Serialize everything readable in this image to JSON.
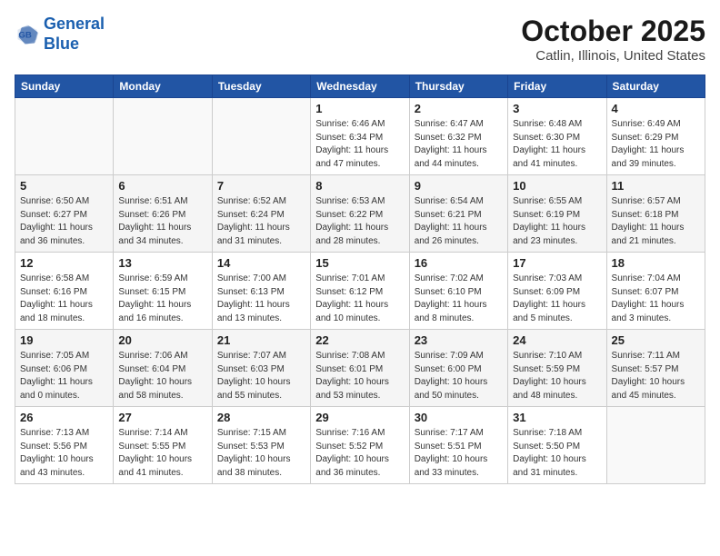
{
  "header": {
    "logo_line1": "General",
    "logo_line2": "Blue",
    "month": "October 2025",
    "location": "Catlin, Illinois, United States"
  },
  "weekdays": [
    "Sunday",
    "Monday",
    "Tuesday",
    "Wednesday",
    "Thursday",
    "Friday",
    "Saturday"
  ],
  "weeks": [
    [
      {
        "day": "",
        "info": ""
      },
      {
        "day": "",
        "info": ""
      },
      {
        "day": "",
        "info": ""
      },
      {
        "day": "1",
        "info": "Sunrise: 6:46 AM\nSunset: 6:34 PM\nDaylight: 11 hours and 47 minutes."
      },
      {
        "day": "2",
        "info": "Sunrise: 6:47 AM\nSunset: 6:32 PM\nDaylight: 11 hours and 44 minutes."
      },
      {
        "day": "3",
        "info": "Sunrise: 6:48 AM\nSunset: 6:30 PM\nDaylight: 11 hours and 41 minutes."
      },
      {
        "day": "4",
        "info": "Sunrise: 6:49 AM\nSunset: 6:29 PM\nDaylight: 11 hours and 39 minutes."
      }
    ],
    [
      {
        "day": "5",
        "info": "Sunrise: 6:50 AM\nSunset: 6:27 PM\nDaylight: 11 hours and 36 minutes."
      },
      {
        "day": "6",
        "info": "Sunrise: 6:51 AM\nSunset: 6:26 PM\nDaylight: 11 hours and 34 minutes."
      },
      {
        "day": "7",
        "info": "Sunrise: 6:52 AM\nSunset: 6:24 PM\nDaylight: 11 hours and 31 minutes."
      },
      {
        "day": "8",
        "info": "Sunrise: 6:53 AM\nSunset: 6:22 PM\nDaylight: 11 hours and 28 minutes."
      },
      {
        "day": "9",
        "info": "Sunrise: 6:54 AM\nSunset: 6:21 PM\nDaylight: 11 hours and 26 minutes."
      },
      {
        "day": "10",
        "info": "Sunrise: 6:55 AM\nSunset: 6:19 PM\nDaylight: 11 hours and 23 minutes."
      },
      {
        "day": "11",
        "info": "Sunrise: 6:57 AM\nSunset: 6:18 PM\nDaylight: 11 hours and 21 minutes."
      }
    ],
    [
      {
        "day": "12",
        "info": "Sunrise: 6:58 AM\nSunset: 6:16 PM\nDaylight: 11 hours and 18 minutes."
      },
      {
        "day": "13",
        "info": "Sunrise: 6:59 AM\nSunset: 6:15 PM\nDaylight: 11 hours and 16 minutes."
      },
      {
        "day": "14",
        "info": "Sunrise: 7:00 AM\nSunset: 6:13 PM\nDaylight: 11 hours and 13 minutes."
      },
      {
        "day": "15",
        "info": "Sunrise: 7:01 AM\nSunset: 6:12 PM\nDaylight: 11 hours and 10 minutes."
      },
      {
        "day": "16",
        "info": "Sunrise: 7:02 AM\nSunset: 6:10 PM\nDaylight: 11 hours and 8 minutes."
      },
      {
        "day": "17",
        "info": "Sunrise: 7:03 AM\nSunset: 6:09 PM\nDaylight: 11 hours and 5 minutes."
      },
      {
        "day": "18",
        "info": "Sunrise: 7:04 AM\nSunset: 6:07 PM\nDaylight: 11 hours and 3 minutes."
      }
    ],
    [
      {
        "day": "19",
        "info": "Sunrise: 7:05 AM\nSunset: 6:06 PM\nDaylight: 11 hours and 0 minutes."
      },
      {
        "day": "20",
        "info": "Sunrise: 7:06 AM\nSunset: 6:04 PM\nDaylight: 10 hours and 58 minutes."
      },
      {
        "day": "21",
        "info": "Sunrise: 7:07 AM\nSunset: 6:03 PM\nDaylight: 10 hours and 55 minutes."
      },
      {
        "day": "22",
        "info": "Sunrise: 7:08 AM\nSunset: 6:01 PM\nDaylight: 10 hours and 53 minutes."
      },
      {
        "day": "23",
        "info": "Sunrise: 7:09 AM\nSunset: 6:00 PM\nDaylight: 10 hours and 50 minutes."
      },
      {
        "day": "24",
        "info": "Sunrise: 7:10 AM\nSunset: 5:59 PM\nDaylight: 10 hours and 48 minutes."
      },
      {
        "day": "25",
        "info": "Sunrise: 7:11 AM\nSunset: 5:57 PM\nDaylight: 10 hours and 45 minutes."
      }
    ],
    [
      {
        "day": "26",
        "info": "Sunrise: 7:13 AM\nSunset: 5:56 PM\nDaylight: 10 hours and 43 minutes."
      },
      {
        "day": "27",
        "info": "Sunrise: 7:14 AM\nSunset: 5:55 PM\nDaylight: 10 hours and 41 minutes."
      },
      {
        "day": "28",
        "info": "Sunrise: 7:15 AM\nSunset: 5:53 PM\nDaylight: 10 hours and 38 minutes."
      },
      {
        "day": "29",
        "info": "Sunrise: 7:16 AM\nSunset: 5:52 PM\nDaylight: 10 hours and 36 minutes."
      },
      {
        "day": "30",
        "info": "Sunrise: 7:17 AM\nSunset: 5:51 PM\nDaylight: 10 hours and 33 minutes."
      },
      {
        "day": "31",
        "info": "Sunrise: 7:18 AM\nSunset: 5:50 PM\nDaylight: 10 hours and 31 minutes."
      },
      {
        "day": "",
        "info": ""
      }
    ]
  ]
}
